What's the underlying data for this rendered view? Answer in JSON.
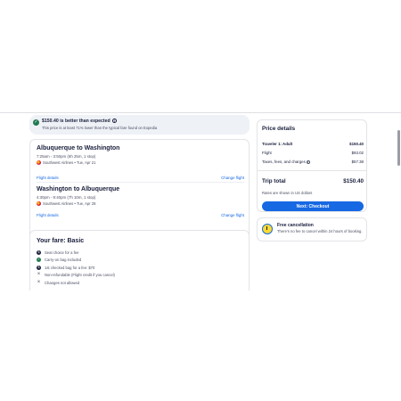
{
  "banner": {
    "title": "$150.40 is better than expected",
    "subtitle": "This price is at least 71% lower than the typical fare found on Expedia"
  },
  "segments": [
    {
      "route": "Albuquerque to Washington",
      "time": "7:25am - 3:50pm (6h 25m, 1 stop)",
      "airline": "Southwest Airlines • Tue, Apr 21",
      "details_label": "Flight details",
      "change_label": "Change flight"
    },
    {
      "route": "Washington to Albuquerque",
      "time": "4:30pm - 9:40pm (7h 10m, 1 stop)",
      "airline": "Southwest Airlines • Tue, Apr 28",
      "details_label": "Flight details",
      "change_label": "Change flight"
    }
  ],
  "fare": {
    "title": "Your fare: Basic",
    "items": [
      {
        "text": "Seat choice for a fee",
        "icon": "seat-icon"
      },
      {
        "text": "Carry-on bag included",
        "icon": "check-icon"
      },
      {
        "text": "1st checked bag for a fee: $70",
        "icon": "bag-icon"
      },
      {
        "text": "Non-refundable (Flight credit if you cancel)",
        "icon": "close-icon"
      },
      {
        "text": "Changes not allowed",
        "icon": "close-icon"
      }
    ]
  },
  "price": {
    "title": "Price details",
    "traveler_label": "Traveler 1: Adult",
    "traveler_value": "$150.40",
    "flight_label": "Flight",
    "flight_value": "$93.02",
    "taxes_label": "Taxes, fees, and charges",
    "taxes_value": "$57.38",
    "total_label": "Trip total",
    "total_value": "$150.40",
    "currency_note": "Rates are shown in US dollars",
    "checkout_label": "Next: Checkout"
  },
  "cancellation": {
    "title": "Free cancellation",
    "subtitle": "There's no fee to cancel within 24 hours of booking."
  },
  "colors": {
    "accent": "#1668e3",
    "success": "#227950",
    "text": "#191e3b"
  }
}
